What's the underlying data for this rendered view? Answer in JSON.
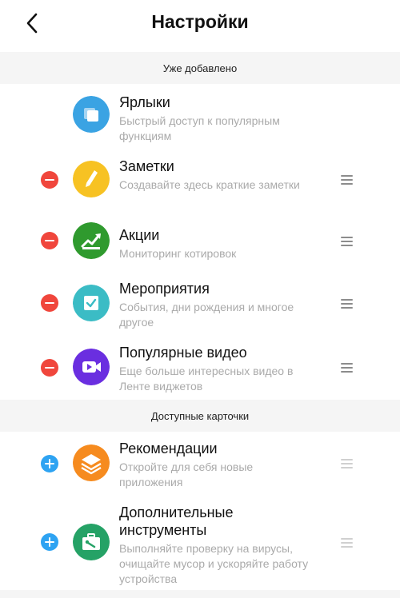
{
  "header": {
    "title": "Настройки",
    "back_icon": "chevron-left-icon"
  },
  "sections": {
    "added": "Уже добавлено",
    "available": "Доступные карточки"
  },
  "added_items": [
    {
      "name": "Ярлыки",
      "desc": "Быстрый доступ к популярным функциям",
      "icon": "shortcuts-icon",
      "color": "#3aa3e3"
    },
    {
      "name": "Заметки",
      "desc": "Создавайте здесь краткие заметки",
      "icon": "pencil-icon",
      "color": "#f7c223"
    },
    {
      "name": "Акции",
      "desc": "Мониторинг котировок",
      "icon": "stock-chart-icon",
      "color": "#2f9a2e"
    },
    {
      "name": "Мероприятия",
      "desc": "События, дни рождения и многое другое",
      "icon": "calendar-check-icon",
      "color": "#3bbcc5"
    },
    {
      "name": "Популярные видео",
      "desc": "Еще больше интересных видео в Ленте виджетов",
      "icon": "video-camera-icon",
      "color": "#6a2ee0"
    }
  ],
  "available_items": [
    {
      "name": "Рекомендации",
      "desc": "Откройте для себя новые приложения",
      "icon": "layers-icon",
      "color": "#f68b1f"
    },
    {
      "name": "Дополнительные инструменты",
      "desc": "Выполняйте проверку на вирусы, очищайте мусор и ускоряйте работу устройства",
      "icon": "toolbox-icon",
      "color": "#25a266"
    }
  ],
  "colors": {
    "remove": "#f0463c",
    "add": "#2ea3f2",
    "section_bg": "#f5f5f5"
  }
}
